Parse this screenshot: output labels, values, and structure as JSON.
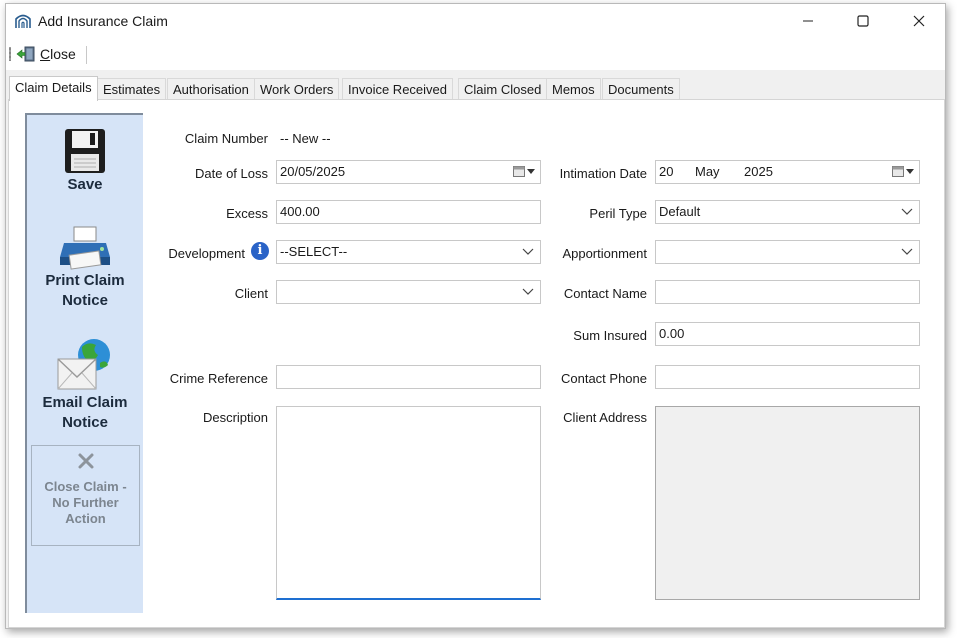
{
  "window": {
    "title": "Add Insurance Claim"
  },
  "toolbar": {
    "close_label": "Close"
  },
  "tabs": [
    {
      "label": "Claim Details",
      "active": true
    },
    {
      "label": "Estimates"
    },
    {
      "label": "Authorisation"
    },
    {
      "label": "Work Orders"
    },
    {
      "label": "Invoice Received"
    },
    {
      "label": "Claim Closed"
    },
    {
      "label": "Memos"
    },
    {
      "label": "Documents"
    }
  ],
  "sidebar": {
    "save": "Save",
    "print_line1": "Print Claim",
    "print_line2": "Notice",
    "email_line1": "Email Claim",
    "email_line2": "Notice",
    "close_claim_line1": "Close Claim -",
    "close_claim_line2": "No Further",
    "close_claim_line3": "Action"
  },
  "form": {
    "claim_number_label": "Claim Number",
    "claim_number_value": "-- New --",
    "date_of_loss_label": "Date of Loss",
    "date_of_loss_value": "20/05/2025",
    "excess_label": "Excess",
    "excess_value": "400.00",
    "development_label": "Development",
    "development_value": "--SELECT--",
    "client_label": "Client",
    "client_value": "",
    "crime_reference_label": "Crime Reference",
    "crime_reference_value": "",
    "description_label": "Description",
    "intimation_date_label": "Intimation Date",
    "intimation_day": "20",
    "intimation_month": "May",
    "intimation_year": "2025",
    "peril_type_label": "Peril Type",
    "peril_type_value": "Default",
    "apportionment_label": "Apportionment",
    "apportionment_value": "",
    "contact_name_label": "Contact Name",
    "contact_name_value": "",
    "sum_insured_label": "Sum Insured",
    "sum_insured_value": "0.00",
    "contact_phone_label": "Contact Phone",
    "contact_phone_value": "",
    "client_address_label": "Client Address"
  },
  "colors": {
    "sidebar_bg": "#d6e4f7",
    "focus_accent": "#1e6fd1",
    "info_icon": "#2a63c7"
  }
}
